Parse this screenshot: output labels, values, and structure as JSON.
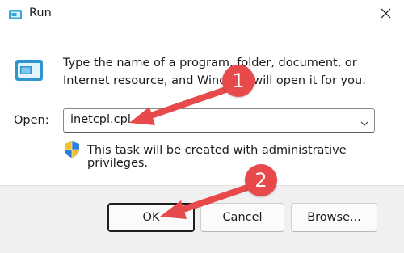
{
  "window": {
    "title": "Run",
    "close_icon": "close-icon"
  },
  "dialog": {
    "description": "Type the name of a program, folder, document, or Internet resource, and Windows will open it for you.",
    "open_label": "Open:",
    "open_value": "inetcpl.cpl",
    "admin_notice": "This task will be created with administrative privileges."
  },
  "buttons": {
    "ok": "OK",
    "cancel": "Cancel",
    "browse": "Browse..."
  },
  "annotations": {
    "step1": "1",
    "step2": "2",
    "color": "#e84a4c"
  },
  "icons": [
    "run-icon",
    "run-dialog-icon",
    "chevron-down-icon",
    "shield-icon",
    "close-icon"
  ]
}
